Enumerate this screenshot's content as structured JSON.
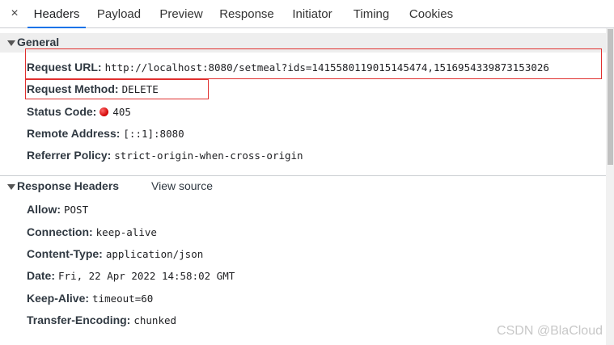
{
  "tabs": {
    "close_icon": "×",
    "items": [
      "Headers",
      "Payload",
      "Preview",
      "Response",
      "Initiator",
      "Timing",
      "Cookies"
    ],
    "active": "Headers"
  },
  "general": {
    "title": "General",
    "request_url_key": "Request URL:",
    "request_url": "http://localhost:8080/setmeal?ids=1415580119015145474,1516954339873153026",
    "request_method_key": "Request Method:",
    "request_method": "DELETE",
    "status_code_key": "Status Code:",
    "status_code": "405",
    "status_color": "#d00000",
    "remote_address_key": "Remote Address:",
    "remote_address": "[::1]:8080",
    "referrer_policy_key": "Referrer Policy:",
    "referrer_policy": "strict-origin-when-cross-origin"
  },
  "response_headers": {
    "title": "Response Headers",
    "view_source": "View source",
    "items": [
      {
        "key": "Allow:",
        "value": "POST"
      },
      {
        "key": "Connection:",
        "value": "keep-alive"
      },
      {
        "key": "Content-Type:",
        "value": "application/json"
      },
      {
        "key": "Date:",
        "value": "Fri, 22 Apr 2022 14:58:02 GMT"
      },
      {
        "key": "Keep-Alive:",
        "value": "timeout=60"
      },
      {
        "key": "Transfer-Encoding:",
        "value": "chunked"
      }
    ]
  },
  "watermark": "CSDN @BlaCloud",
  "colors": {
    "accent": "#1a73e8",
    "highlight_border": "#e0302f",
    "section_bg": "#eeeeee"
  }
}
